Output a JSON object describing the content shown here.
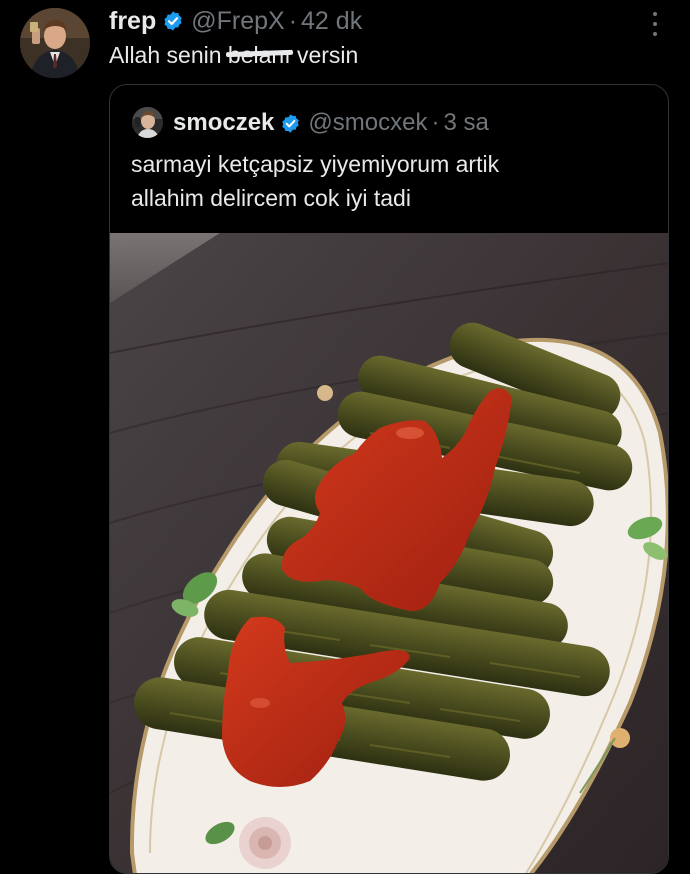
{
  "tweet": {
    "author_name": "frep",
    "handle": "@FrepX",
    "separator": "·",
    "time": "42 dk",
    "text_before": "Allah senin ",
    "text_scribbled": "belanı",
    "text_after": " versin"
  },
  "quote": {
    "author_name": "smoczek",
    "handle": "@smocxek",
    "separator": "·",
    "time": "3 sa",
    "line1": "sarmayi ketçapsiz yiyemiyorum artik",
    "line2": "allahim delircem cok iyi tadi"
  },
  "photo": {
    "subject": "stuffed grape leaves with ketchup"
  },
  "colors": {
    "background": "#000000",
    "text": "#e7e9ea",
    "secondary": "#71767b",
    "verified": "#1d9bf0",
    "border": "#2f3336"
  }
}
